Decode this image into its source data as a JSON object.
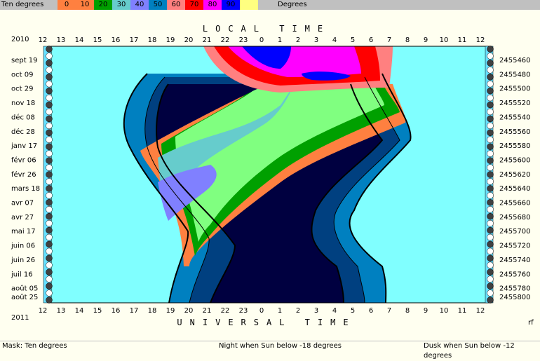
{
  "header": {
    "left_label": "Ten degrees",
    "right_label": "Degrees",
    "scale": [
      {
        "label": "0",
        "color": "#ff8040"
      },
      {
        "label": "10",
        "color": "#ff8040"
      },
      {
        "label": "20",
        "color": "#00a000"
      },
      {
        "label": "30",
        "color": "#66cccc"
      },
      {
        "label": "40",
        "color": "#8080ff"
      },
      {
        "label": "50",
        "color": "#0080c0"
      },
      {
        "label": "60",
        "color": "#ff8080"
      },
      {
        "label": "70",
        "color": "#ff0000"
      },
      {
        "label": "80",
        "color": "#ff00ff"
      },
      {
        "label": "90",
        "color": "#0000ff"
      },
      {
        "label": "",
        "color": "#ffff80"
      }
    ]
  },
  "status": {
    "mask": "Mask:  Ten degrees",
    "night": "Night when Sun below -18 degrees",
    "dusk": "Dusk when Sun below -12 degrees"
  },
  "chart_data": {
    "type": "heatmap",
    "top_title": "LOCAL TIME",
    "bottom_title": "UNIVERSAL TIME",
    "year_top": "2010",
    "year_bottom": "2011",
    "corner_label": "rf",
    "hour_ticks": [
      "12",
      "13",
      "14",
      "15",
      "16",
      "17",
      "18",
      "19",
      "20",
      "21",
      "22",
      "23",
      "0",
      "1",
      "2",
      "3",
      "4",
      "5",
      "6",
      "7",
      "8",
      "9",
      "10",
      "11",
      "12"
    ],
    "date_labels": [
      "sept 19",
      "oct 09",
      "oct 29",
      "nov 18",
      "déc 08",
      "déc 28",
      "janv 17",
      "févr 06",
      "févr 26",
      "mars 18",
      "avr 07",
      "avr 27",
      "mai 17",
      "juin 06",
      "juin 26",
      "juil 16",
      "août 05",
      "août 25"
    ],
    "jd_labels": [
      "2455460",
      "2455480",
      "2455500",
      "2455520",
      "2455540",
      "2455560",
      "2455580",
      "2455600",
      "2455620",
      "2455640",
      "2455660",
      "2455680",
      "2455700",
      "2455720",
      "2455740",
      "2455760",
      "2455780",
      "2455800"
    ],
    "colors": {
      "day": "#80ffff",
      "night": "#000040",
      "dusk": "#004080",
      "twilight": "#0080c0",
      "alt0": "#ff8040",
      "alt10": "#00a000",
      "alt20": "#80ff80",
      "alt30": "#66cccc",
      "alt40": "#8080ff",
      "alt60": "#ff8080",
      "alt70": "#ff0000",
      "alt80": "#ff00ff",
      "alt90": "#0000ff"
    }
  }
}
